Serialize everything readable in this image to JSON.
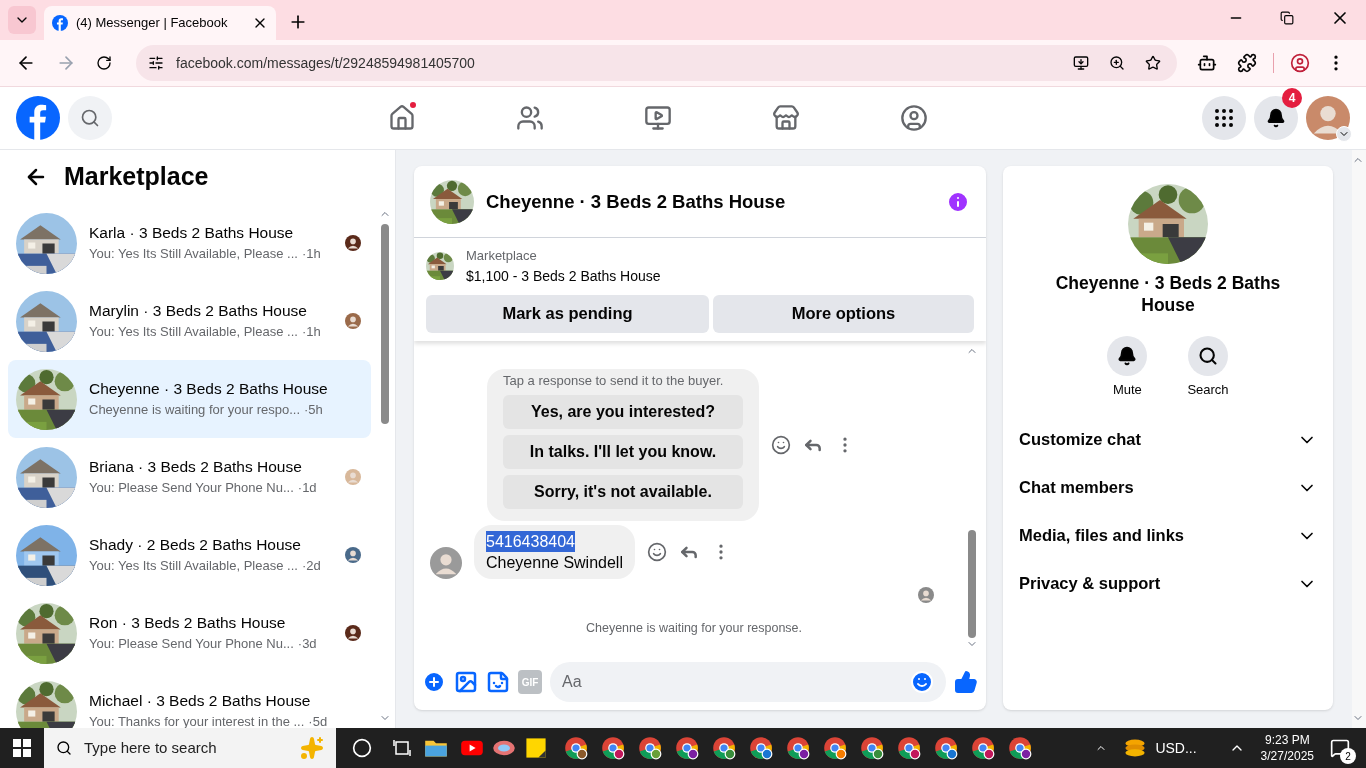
{
  "browser": {
    "tab_title": "(4) Messenger | Facebook",
    "url": "facebook.com/messages/t/29248594981405700"
  },
  "header": {
    "nav": [
      {
        "kind": "home",
        "dot": true
      },
      {
        "kind": "friends",
        "dot": false
      },
      {
        "kind": "video",
        "dot": false
      },
      {
        "kind": "marketplace",
        "dot": false
      },
      {
        "kind": "groups",
        "dot": false
      }
    ],
    "notifications": "4"
  },
  "sidebar": {
    "title": "Marketplace",
    "conversations": [
      {
        "title": "Karla · 3 Beds 2 Baths House",
        "preview": "You: Yes Its Still Available, Please ...",
        "time": "·1h",
        "selected": false,
        "seen": true
      },
      {
        "title": "Marylin · 3 Beds 2 Baths House",
        "preview": "You: Yes Its Still Available, Please ...",
        "time": "·1h",
        "selected": false,
        "seen": true
      },
      {
        "title": "Cheyenne · 3 Beds 2 Baths House",
        "preview": "Cheyenne is waiting for your respo...",
        "time": "·5h",
        "selected": true,
        "seen": false
      },
      {
        "title": "Briana · 3 Beds 2 Baths House",
        "preview": "You: Please Send Your Phone Nu...",
        "time": "·1d",
        "selected": false,
        "seen": true
      },
      {
        "title": "Shady · 2 Beds 2 Baths House",
        "preview": "You: Yes Its Still Available, Please ...",
        "time": "·2d",
        "selected": false,
        "seen": true
      },
      {
        "title": "Ron · 3 Beds 2 Baths House",
        "preview": "You: Please Send Your Phone Nu...",
        "time": "·3d",
        "selected": false,
        "seen": true
      },
      {
        "title": "Michael · 3 Beds 2 Baths House",
        "preview": "You: Thanks for your interest in the ...",
        "time": "·5d",
        "selected": false,
        "seen": false
      }
    ]
  },
  "chat": {
    "title": "Cheyenne · 3 Beds 2 Baths House",
    "listing": {
      "label": "Marketplace",
      "title": "$1,100 - 3 Beds 2 Baths House"
    },
    "buttons": [
      "Mark as pending",
      "More options"
    ],
    "quick_replies": {
      "note": "Tap a response to send it to the buyer.",
      "options": [
        "Yes, are you interested?",
        "In talks. I'll let you know.",
        "Sorry, it's not available."
      ]
    },
    "message": {
      "lines": [
        {
          "text": "5416438404",
          "highlighted": true
        },
        {
          "text": "Cheyenne Swindell",
          "highlighted": false
        }
      ]
    },
    "status": "Cheyenne is waiting for your response.",
    "composer": {
      "gif_label": "GIF",
      "placeholder": "Aa"
    }
  },
  "details": {
    "title": "Cheyenne · 3 Beds 2 Baths House",
    "actions": [
      {
        "kind": "mute",
        "label": "Mute"
      },
      {
        "kind": "search",
        "label": "Search"
      }
    ],
    "sections": [
      {
        "label": "Customize chat",
        "expanded": false
      },
      {
        "label": "Chat members",
        "expanded": false
      },
      {
        "label": "Media, files and links",
        "expanded": false
      },
      {
        "label": "Privacy & support",
        "expanded": false
      }
    ]
  },
  "taskbar": {
    "search_placeholder": "Type here to search",
    "tray_label": "USD...",
    "time": "9:23 PM",
    "date": "3/27/2025",
    "notification_count": "2"
  }
}
